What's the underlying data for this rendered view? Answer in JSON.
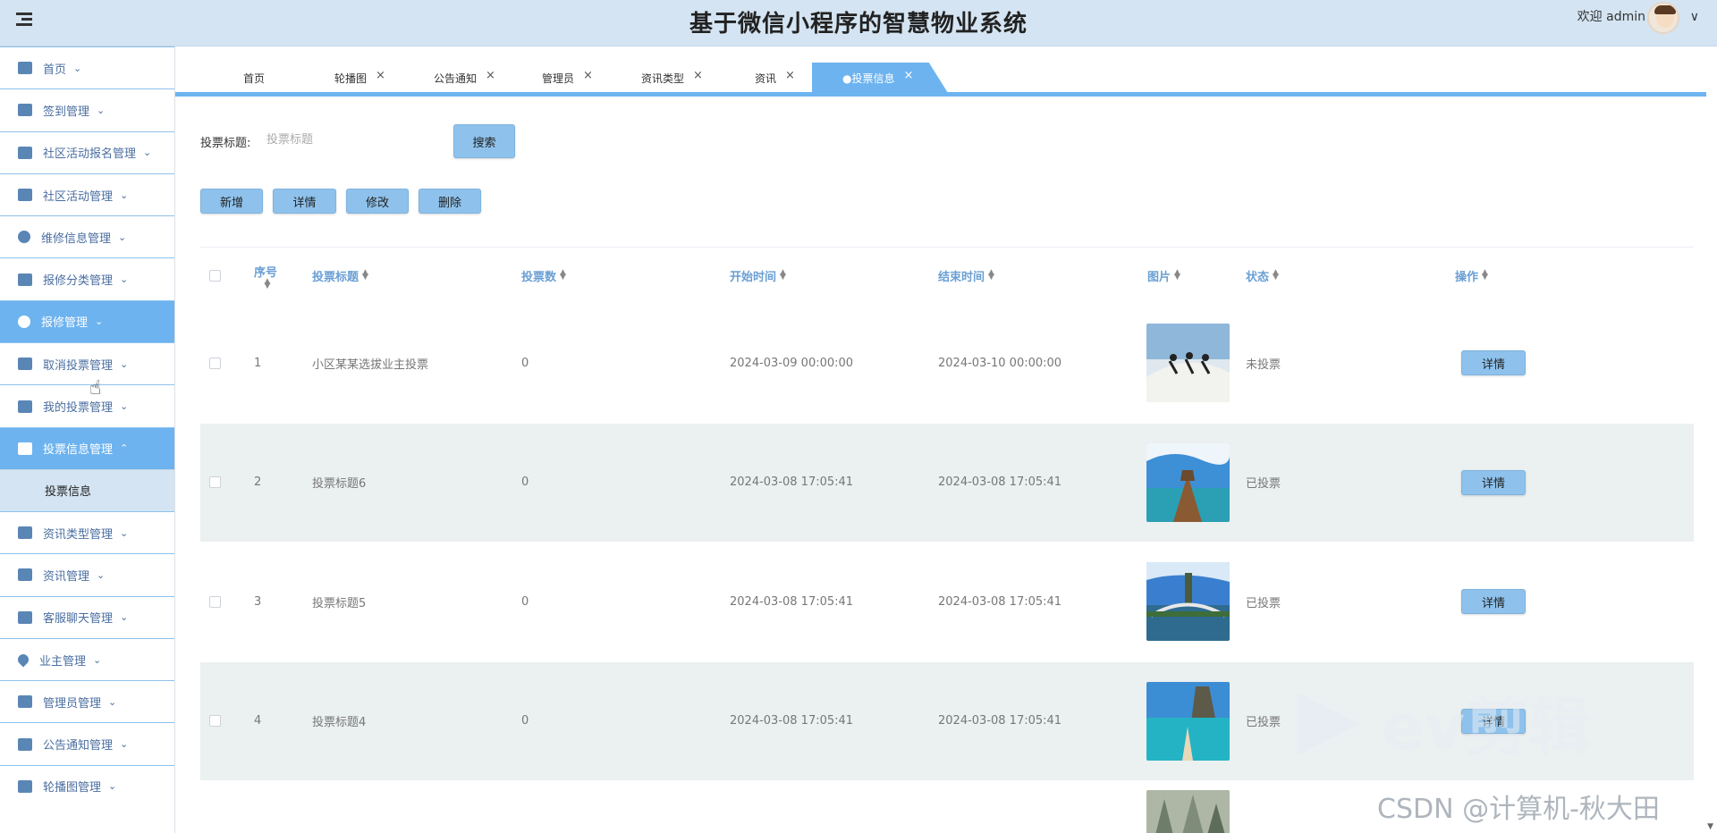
{
  "header": {
    "title": "基于微信小程序的智慧物业系统",
    "welcome": "欢迎 admin",
    "chevron": "∨"
  },
  "sidebar": {
    "items": [
      {
        "label": "首页",
        "icon": "home-icon"
      },
      {
        "label": "签到管理",
        "icon": "checkin-icon"
      },
      {
        "label": "社区活动报名管理",
        "icon": "grid-icon"
      },
      {
        "label": "社区活动管理",
        "icon": "panel-icon"
      },
      {
        "label": "维修信息管理",
        "icon": "circle-icon"
      },
      {
        "label": "报修分类管理",
        "icon": "dashboard-icon"
      },
      {
        "label": "报修管理",
        "icon": "gauge-icon"
      },
      {
        "label": "取消投票管理",
        "icon": "list-icon"
      },
      {
        "label": "我的投票管理",
        "icon": "edit-icon"
      },
      {
        "label": "投票信息管理",
        "icon": "mail-icon"
      },
      {
        "label": "资讯类型管理",
        "icon": "ticket-icon"
      },
      {
        "label": "资讯管理",
        "icon": "news-icon"
      },
      {
        "label": "客服聊天管理",
        "icon": "bag-icon"
      },
      {
        "label": "业主管理",
        "icon": "drop-icon"
      },
      {
        "label": "管理员管理",
        "icon": "columns-icon"
      },
      {
        "label": "公告通知管理",
        "icon": "chart-icon"
      },
      {
        "label": "轮播图管理",
        "icon": "slider-icon"
      }
    ],
    "sub_item": "投票信息",
    "chevron_down": "⌄",
    "chevron_up": "⌃"
  },
  "tabs": [
    {
      "label": "首页"
    },
    {
      "label": "轮播图"
    },
    {
      "label": "公告通知"
    },
    {
      "label": "管理员"
    },
    {
      "label": "资讯类型"
    },
    {
      "label": "资讯"
    },
    {
      "label": "●投票信息"
    }
  ],
  "tab_close": "×",
  "search": {
    "label": "投票标题:",
    "placeholder": "投票标题",
    "button": "搜索"
  },
  "actions": {
    "add": "新增",
    "detail": "详情",
    "edit": "修改",
    "delete": "删除"
  },
  "table": {
    "headers": {
      "index": "序号",
      "title": "投票标题",
      "count": "投票数",
      "start": "开始时间",
      "end": "结束时间",
      "image": "图片",
      "status": "状态",
      "op": "操作"
    },
    "sort_glyph": "▲▼",
    "rows": [
      {
        "index": "1",
        "title": "小区某某选拔业主投票",
        "count": "0",
        "start": "2024-03-09 00:00:00",
        "end": "2024-03-10 00:00:00",
        "status": "未投票",
        "action": "详情"
      },
      {
        "index": "2",
        "title": "投票标题6",
        "count": "0",
        "start": "2024-03-08 17:05:41",
        "end": "2024-03-08 17:05:41",
        "status": "已投票",
        "action": "详情"
      },
      {
        "index": "3",
        "title": "投票标题5",
        "count": "0",
        "start": "2024-03-08 17:05:41",
        "end": "2024-03-08 17:05:41",
        "status": "已投票",
        "action": "详情"
      },
      {
        "index": "4",
        "title": "投票标题4",
        "count": "0",
        "start": "2024-03-08 17:05:41",
        "end": "2024-03-08 17:05:41",
        "status": "已投票",
        "action": "详情"
      }
    ]
  },
  "watermark": {
    "ev_text": "ev剪辑",
    "csdn": "CSDN @计算机-秋大田"
  },
  "colors": {
    "accent": "#6db3ef",
    "button": "#8ec2ec",
    "header_bg": "#d4e4f2"
  }
}
